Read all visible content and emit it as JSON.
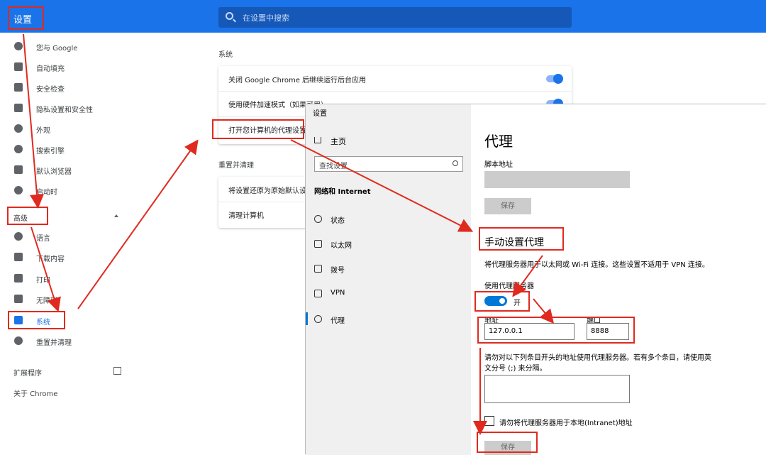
{
  "chrome": {
    "app_title": "设置",
    "search_placeholder": "在设置中搜索",
    "sidebar": {
      "items": [
        {
          "label": "您与 Google"
        },
        {
          "label": "自动填充"
        },
        {
          "label": "安全检查"
        },
        {
          "label": "隐私设置和安全性"
        },
        {
          "label": "外观"
        },
        {
          "label": "搜索引擎"
        },
        {
          "label": "默认浏览器"
        },
        {
          "label": "启动时"
        }
      ],
      "advanced_label": "高级",
      "advanced_items": [
        {
          "label": "语言"
        },
        {
          "label": "下载内容"
        },
        {
          "label": "打印"
        },
        {
          "label": "无障碍"
        },
        {
          "label": "系统"
        },
        {
          "label": "重置并清理"
        }
      ],
      "extensions_label": "扩展程序",
      "about_label": "关于 Chrome"
    },
    "main": {
      "system_title": "系统",
      "system_rows": [
        {
          "label": "关闭 Google Chrome 后继续运行后台应用"
        },
        {
          "label": "使用硬件加速模式（如果可用）"
        },
        {
          "label": "打开您计算机的代理设置"
        }
      ],
      "reset_title": "重置并清理",
      "reset_rows": [
        {
          "label": "将设置还原为原始默认设置"
        },
        {
          "label": "清理计算机"
        }
      ]
    }
  },
  "windows": {
    "title": "设置",
    "home_label": "主页",
    "search_placeholder": "查找设置",
    "category": "网络和 Internet",
    "nav": [
      {
        "label": "状态"
      },
      {
        "label": "以太网"
      },
      {
        "label": "拨号"
      },
      {
        "label": "VPN"
      },
      {
        "label": "代理"
      }
    ],
    "heading": "代理",
    "script_address_label": "脚本地址",
    "save_label": "保存",
    "manual_heading": "手动设置代理",
    "manual_desc": "将代理服务器用于以太网或 Wi-Fi 连接。这些设置不适用于 VPN 连接。",
    "use_proxy_label": "使用代理服务器",
    "toggle_state": "开",
    "address_label": "地址",
    "address_value": "127.0.0.1",
    "port_label": "端口",
    "port_value": "8888",
    "exceptions_desc_line1": "请勿对以下列条目开头的地址使用代理服务器。若有多个条目，请使用英",
    "exceptions_desc_line2": "文分号 (;) 来分隔。",
    "local_checkbox_label": "请勿将代理服务器用于本地(Intranet)地址",
    "save_label_2": "保存"
  },
  "colors": {
    "chrome_blue": "#1a73e8",
    "annotation_red": "#e02a1f",
    "windows_accent": "#0078d7"
  }
}
